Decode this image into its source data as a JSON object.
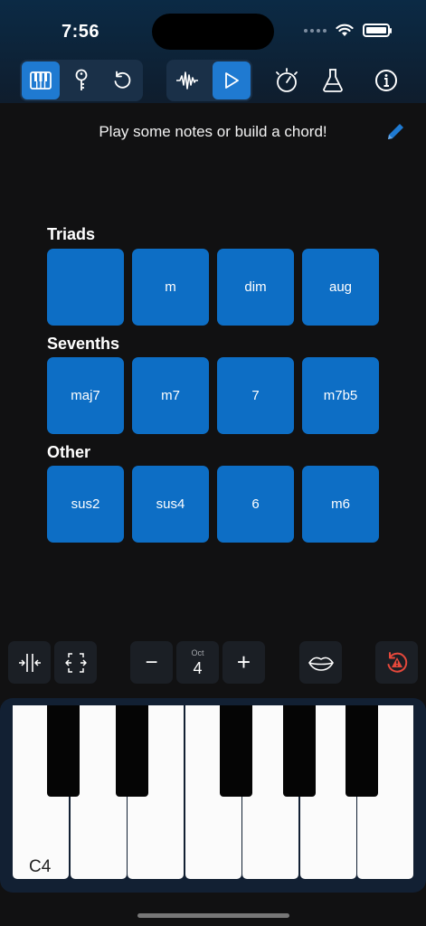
{
  "status": {
    "time": "7:56"
  },
  "toolbar": {
    "left_group": [
      "piano-icon",
      "key-icon",
      "undo-icon"
    ],
    "middle_group": [
      "waveform-icon",
      "play-icon"
    ],
    "right_items": [
      "metronome-icon",
      "flask-icon",
      "info-icon"
    ],
    "active_items": [
      "piano-icon",
      "play-icon"
    ]
  },
  "prompt": {
    "text": "Play some notes or build a chord!"
  },
  "sections": [
    {
      "title": "Triads",
      "chords": [
        "",
        "m",
        "dim",
        "aug"
      ]
    },
    {
      "title": "Sevenths",
      "chords": [
        "maj7",
        "m7",
        "7",
        "m7b5"
      ]
    },
    {
      "title": "Other",
      "chords": [
        "sus2",
        "sus4",
        "6",
        "m6"
      ]
    }
  ],
  "controls": {
    "octave_label": "Oct",
    "octave_value": "4",
    "minus_label": "−",
    "plus_label": "+"
  },
  "keyboard": {
    "first_label": "C4"
  },
  "colors": {
    "accent": "#1f7ad1",
    "chord_button": "#0d6ec5",
    "alert": "#e5483b"
  }
}
